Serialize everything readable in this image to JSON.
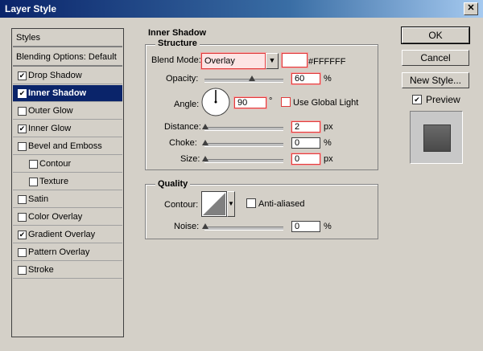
{
  "window": {
    "title": "Layer Style",
    "close_glyph": "✕"
  },
  "sidebar": {
    "header": "Styles",
    "blending": "Blending Options: Default",
    "items": [
      {
        "label": "Drop Shadow",
        "checked": true,
        "selected": false,
        "indent": false
      },
      {
        "label": "Inner Shadow",
        "checked": true,
        "selected": true,
        "indent": false
      },
      {
        "label": "Outer Glow",
        "checked": false,
        "selected": false,
        "indent": false
      },
      {
        "label": "Inner Glow",
        "checked": true,
        "selected": false,
        "indent": false
      },
      {
        "label": "Bevel and Emboss",
        "checked": false,
        "selected": false,
        "indent": false
      },
      {
        "label": "Contour",
        "checked": false,
        "selected": false,
        "indent": true
      },
      {
        "label": "Texture",
        "checked": false,
        "selected": false,
        "indent": true
      },
      {
        "label": "Satin",
        "checked": false,
        "selected": false,
        "indent": false
      },
      {
        "label": "Color Overlay",
        "checked": false,
        "selected": false,
        "indent": false
      },
      {
        "label": "Gradient Overlay",
        "checked": true,
        "selected": false,
        "indent": false
      },
      {
        "label": "Pattern Overlay",
        "checked": false,
        "selected": false,
        "indent": false
      },
      {
        "label": "Stroke",
        "checked": false,
        "selected": false,
        "indent": false
      }
    ]
  },
  "inner_shadow": {
    "section_title": "Inner Shadow",
    "structure_title": "Structure",
    "blend_mode_label": "Blend Mode:",
    "blend_mode_value": "Overlay",
    "color_hex": "#FFFFFF",
    "opacity_label": "Opacity:",
    "opacity_value": "60",
    "opacity_percent": 60,
    "percent_unit": "%",
    "angle_label": "Angle:",
    "angle_value": "90",
    "degree_unit": "°",
    "use_global_light_label": "Use Global Light",
    "use_global_light": false,
    "distance_label": "Distance:",
    "distance_value": "2",
    "px_unit": "px",
    "choke_label": "Choke:",
    "choke_value": "0",
    "size_label": "Size:",
    "size_value": "0",
    "quality_title": "Quality",
    "contour_label": "Contour:",
    "anti_aliased_label": "Anti-aliased",
    "anti_aliased": false,
    "noise_label": "Noise:",
    "noise_value": "0"
  },
  "buttons": {
    "ok": "OK",
    "cancel": "Cancel",
    "new_style": "New Style..."
  },
  "preview": {
    "label": "Preview",
    "checked": true
  },
  "colors": {
    "highlight_border": "#e03c3c",
    "selection": "#0a246a"
  },
  "icons": {
    "dropdown": "chevron-down-icon",
    "check": "checkmark-icon"
  }
}
